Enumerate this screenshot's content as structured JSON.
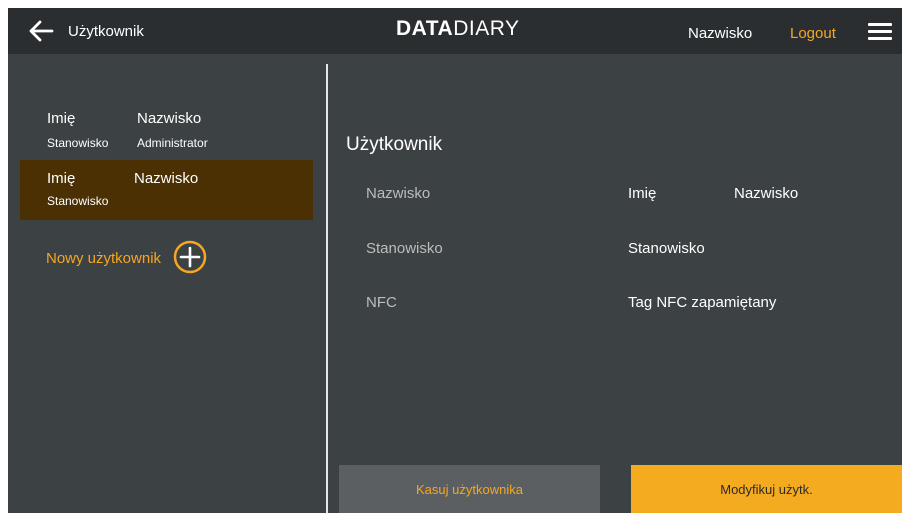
{
  "header": {
    "title": "Użytkownik",
    "brand_bold": "DATA",
    "brand_light": "DIARY",
    "user_name": "Nazwisko",
    "logout_label": "Logout",
    "icons": {
      "back": "arrow-left-icon",
      "menu": "hamburger-menu-icon"
    }
  },
  "sidebar": {
    "users": [
      {
        "first": "Imię",
        "last": "Nazwisko",
        "position": "Stanowisko",
        "role": "Administrator",
        "selected": false
      },
      {
        "first": "Imię",
        "last": "Nazwisko",
        "position": "Stanowisko",
        "role": "",
        "selected": true
      }
    ],
    "new_user_label": "Nowy użytkownik",
    "new_user_icon": "plus-circle-icon"
  },
  "detail": {
    "title": "Użytkownik",
    "rows": [
      {
        "label": "Nazwisko",
        "value": "Imię",
        "value2": "Nazwisko"
      },
      {
        "label": "Stanowisko",
        "value": "Stanowisko"
      },
      {
        "label": "NFC",
        "value": "Tag NFC zapamiętany"
      }
    ]
  },
  "actions": {
    "delete_label": "Kasuj użytkownika",
    "modify_label": "Modyfikuj użytk."
  },
  "colors": {
    "accent": "#f5a623",
    "topbar": "#2b2e30",
    "background": "#3c4144",
    "selected_row": "#4a3003",
    "delete_button": "#5b5f62",
    "modify_button": "#f5ab1f"
  }
}
